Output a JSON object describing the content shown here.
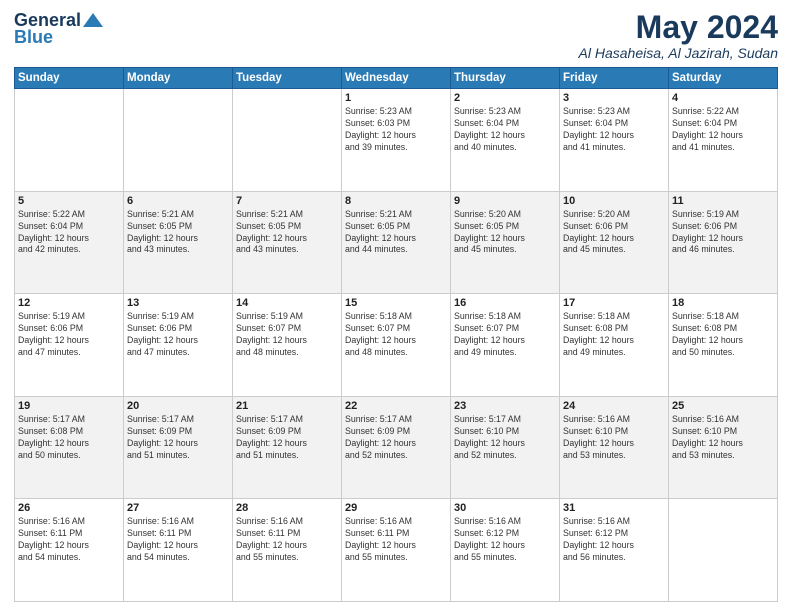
{
  "header": {
    "logo_line1": "General",
    "logo_line2": "Blue",
    "main_title": "May 2024",
    "subtitle": "Al Hasaheisa, Al Jazirah, Sudan"
  },
  "days_of_week": [
    "Sunday",
    "Monday",
    "Tuesday",
    "Wednesday",
    "Thursday",
    "Friday",
    "Saturday"
  ],
  "weeks": [
    [
      {
        "day": "",
        "info": ""
      },
      {
        "day": "",
        "info": ""
      },
      {
        "day": "",
        "info": ""
      },
      {
        "day": "1",
        "info": "Sunrise: 5:23 AM\nSunset: 6:03 PM\nDaylight: 12 hours\nand 39 minutes."
      },
      {
        "day": "2",
        "info": "Sunrise: 5:23 AM\nSunset: 6:04 PM\nDaylight: 12 hours\nand 40 minutes."
      },
      {
        "day": "3",
        "info": "Sunrise: 5:23 AM\nSunset: 6:04 PM\nDaylight: 12 hours\nand 41 minutes."
      },
      {
        "day": "4",
        "info": "Sunrise: 5:22 AM\nSunset: 6:04 PM\nDaylight: 12 hours\nand 41 minutes."
      }
    ],
    [
      {
        "day": "5",
        "info": "Sunrise: 5:22 AM\nSunset: 6:04 PM\nDaylight: 12 hours\nand 42 minutes."
      },
      {
        "day": "6",
        "info": "Sunrise: 5:21 AM\nSunset: 6:05 PM\nDaylight: 12 hours\nand 43 minutes."
      },
      {
        "day": "7",
        "info": "Sunrise: 5:21 AM\nSunset: 6:05 PM\nDaylight: 12 hours\nand 43 minutes."
      },
      {
        "day": "8",
        "info": "Sunrise: 5:21 AM\nSunset: 6:05 PM\nDaylight: 12 hours\nand 44 minutes."
      },
      {
        "day": "9",
        "info": "Sunrise: 5:20 AM\nSunset: 6:05 PM\nDaylight: 12 hours\nand 45 minutes."
      },
      {
        "day": "10",
        "info": "Sunrise: 5:20 AM\nSunset: 6:06 PM\nDaylight: 12 hours\nand 45 minutes."
      },
      {
        "day": "11",
        "info": "Sunrise: 5:19 AM\nSunset: 6:06 PM\nDaylight: 12 hours\nand 46 minutes."
      }
    ],
    [
      {
        "day": "12",
        "info": "Sunrise: 5:19 AM\nSunset: 6:06 PM\nDaylight: 12 hours\nand 47 minutes."
      },
      {
        "day": "13",
        "info": "Sunrise: 5:19 AM\nSunset: 6:06 PM\nDaylight: 12 hours\nand 47 minutes."
      },
      {
        "day": "14",
        "info": "Sunrise: 5:19 AM\nSunset: 6:07 PM\nDaylight: 12 hours\nand 48 minutes."
      },
      {
        "day": "15",
        "info": "Sunrise: 5:18 AM\nSunset: 6:07 PM\nDaylight: 12 hours\nand 48 minutes."
      },
      {
        "day": "16",
        "info": "Sunrise: 5:18 AM\nSunset: 6:07 PM\nDaylight: 12 hours\nand 49 minutes."
      },
      {
        "day": "17",
        "info": "Sunrise: 5:18 AM\nSunset: 6:08 PM\nDaylight: 12 hours\nand 49 minutes."
      },
      {
        "day": "18",
        "info": "Sunrise: 5:18 AM\nSunset: 6:08 PM\nDaylight: 12 hours\nand 50 minutes."
      }
    ],
    [
      {
        "day": "19",
        "info": "Sunrise: 5:17 AM\nSunset: 6:08 PM\nDaylight: 12 hours\nand 50 minutes."
      },
      {
        "day": "20",
        "info": "Sunrise: 5:17 AM\nSunset: 6:09 PM\nDaylight: 12 hours\nand 51 minutes."
      },
      {
        "day": "21",
        "info": "Sunrise: 5:17 AM\nSunset: 6:09 PM\nDaylight: 12 hours\nand 51 minutes."
      },
      {
        "day": "22",
        "info": "Sunrise: 5:17 AM\nSunset: 6:09 PM\nDaylight: 12 hours\nand 52 minutes."
      },
      {
        "day": "23",
        "info": "Sunrise: 5:17 AM\nSunset: 6:10 PM\nDaylight: 12 hours\nand 52 minutes."
      },
      {
        "day": "24",
        "info": "Sunrise: 5:16 AM\nSunset: 6:10 PM\nDaylight: 12 hours\nand 53 minutes."
      },
      {
        "day": "25",
        "info": "Sunrise: 5:16 AM\nSunset: 6:10 PM\nDaylight: 12 hours\nand 53 minutes."
      }
    ],
    [
      {
        "day": "26",
        "info": "Sunrise: 5:16 AM\nSunset: 6:11 PM\nDaylight: 12 hours\nand 54 minutes."
      },
      {
        "day": "27",
        "info": "Sunrise: 5:16 AM\nSunset: 6:11 PM\nDaylight: 12 hours\nand 54 minutes."
      },
      {
        "day": "28",
        "info": "Sunrise: 5:16 AM\nSunset: 6:11 PM\nDaylight: 12 hours\nand 55 minutes."
      },
      {
        "day": "29",
        "info": "Sunrise: 5:16 AM\nSunset: 6:11 PM\nDaylight: 12 hours\nand 55 minutes."
      },
      {
        "day": "30",
        "info": "Sunrise: 5:16 AM\nSunset: 6:12 PM\nDaylight: 12 hours\nand 55 minutes."
      },
      {
        "day": "31",
        "info": "Sunrise: 5:16 AM\nSunset: 6:12 PM\nDaylight: 12 hours\nand 56 minutes."
      },
      {
        "day": "",
        "info": ""
      }
    ]
  ]
}
